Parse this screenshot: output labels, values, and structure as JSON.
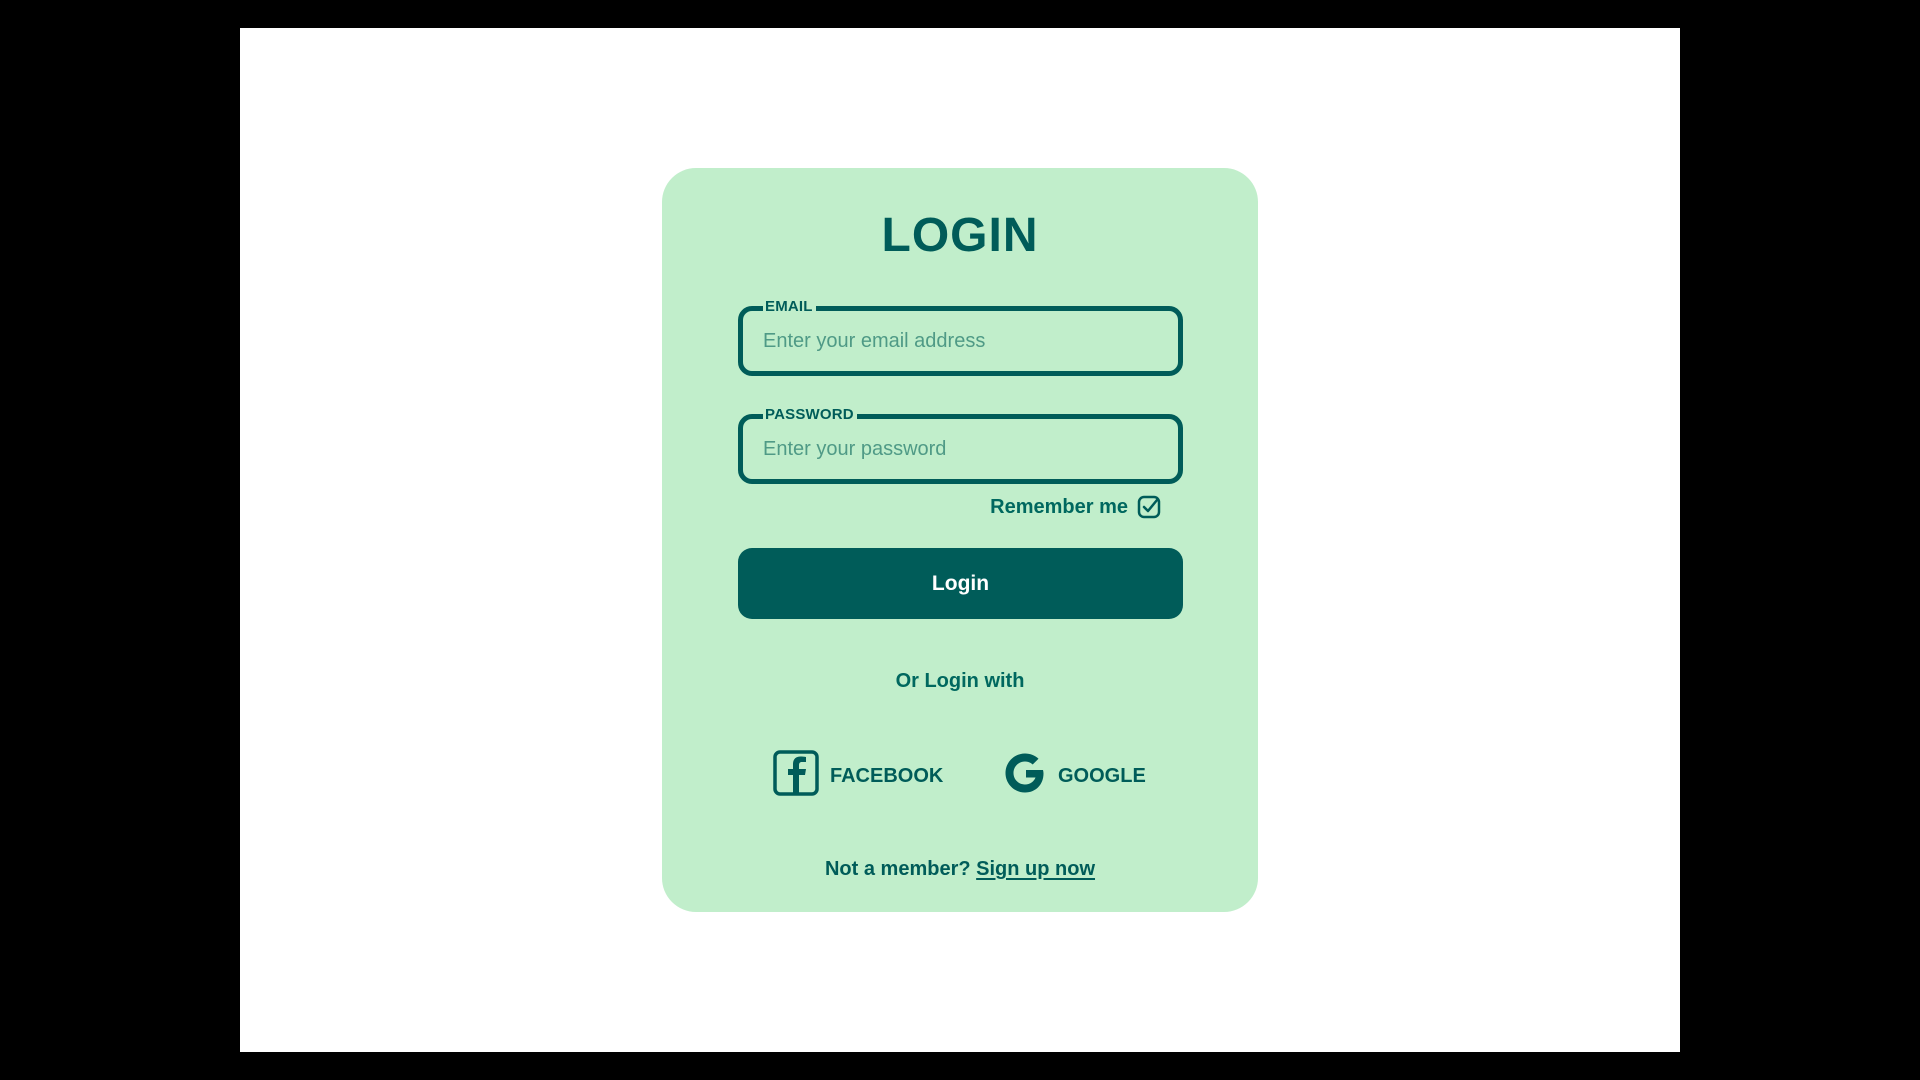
{
  "login_card": {
    "title": "LOGIN",
    "email": {
      "label": "EMAIL",
      "placeholder": "Enter your email address",
      "value": ""
    },
    "password": {
      "label": "PASSWORD",
      "placeholder": "Enter your password",
      "value": ""
    },
    "remember_me": {
      "label": "Remember me",
      "checked": true,
      "icon": "checkbox-checked-icon"
    },
    "login_button": "Login",
    "divider_text": "Or Login with",
    "social": [
      {
        "label": "FACEBOOK",
        "icon": "facebook-icon"
      },
      {
        "label": "GOOGLE",
        "icon": "google-icon"
      }
    ],
    "footer": {
      "text": "Not a member?",
      "link": "Sign up now"
    }
  },
  "colors": {
    "card_background": "#c1eecb",
    "accent": "#005c59",
    "page_background": "#ffffff",
    "outer_frame": "#000000"
  }
}
